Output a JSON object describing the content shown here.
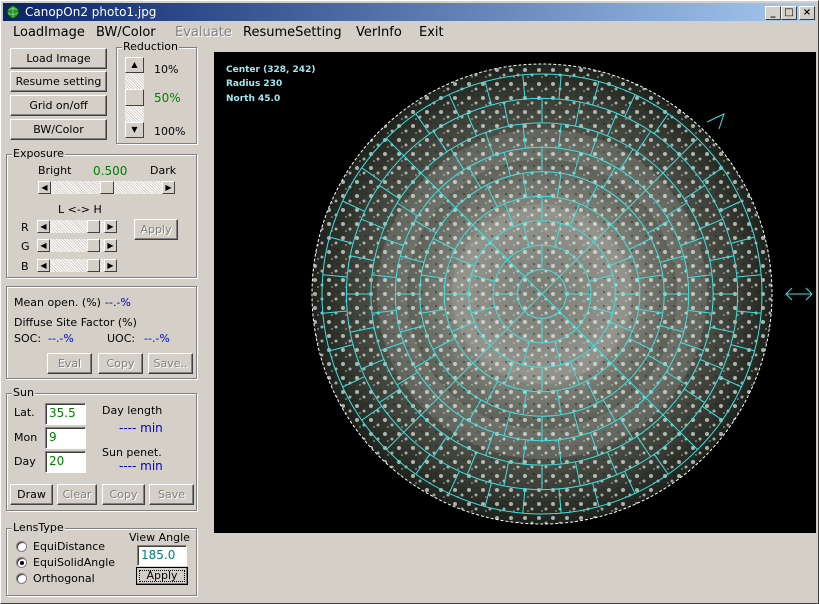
{
  "title": "CanopOn2  photo1.jpg",
  "window_buttons": {
    "minimize": "_",
    "maximize": "□",
    "close": "×"
  },
  "menu": [
    {
      "label": "LoadImage",
      "enabled": true
    },
    {
      "label": "BW/Color",
      "enabled": true
    },
    {
      "label": "Evaluate",
      "enabled": false
    },
    {
      "label": "ResumeSetting",
      "enabled": true
    },
    {
      "label": "VerInfo",
      "enabled": true
    },
    {
      "label": "Exit",
      "enabled": true
    }
  ],
  "toolbar": {
    "load_image": "Load Image",
    "resume_setting": "Resume setting",
    "grid": "Grid on/off",
    "bw_color": "BW/Color"
  },
  "reduction": {
    "title": "Reduction",
    "top": "10%",
    "current": "50%",
    "bottom": "100%"
  },
  "exposure": {
    "title": "Exposure",
    "bright": "Bright",
    "value": "0.500",
    "dark": "Dark",
    "lh": "L <-> H",
    "r": "R",
    "g": "G",
    "b": "B",
    "apply": "Apply"
  },
  "eval": {
    "mean_label": "Mean open. (%)",
    "mean_value": "--.-%",
    "dsf_label": "Diffuse Site Factor (%)",
    "soc_label": "SOC:",
    "soc_value": "--.-%",
    "uoc_label": "UOC:",
    "uoc_value": "--.-%",
    "eval_btn": "Eval",
    "copy_btn": "Copy",
    "save_btn": "Save.."
  },
  "sun": {
    "title": "Sun",
    "lat_label": "Lat.",
    "lat": "35.5",
    "mon_label": "Mon",
    "mon": "9",
    "day_label": "Day",
    "day": "20",
    "daylength_label": "Day length",
    "daylength_value": "----  min",
    "penet_label": "Sun penet.",
    "penet_value": "----  min",
    "draw": "Draw",
    "clear": "Clear",
    "copy": "Copy",
    "save": "Save"
  },
  "lens": {
    "title": "LensType",
    "options": [
      "EquiDistance",
      "EquiSolidAngle",
      "Orthogonal"
    ],
    "selected": "EquiSolidAngle",
    "view_angle_label": "View Angle",
    "view_angle": "185.0",
    "apply": "Apply"
  },
  "image_info": {
    "center": "Center (328, 242)",
    "radius": "Radius 230",
    "north": "North 45.0"
  },
  "colors": {
    "grid": "#40e0e0",
    "info_text": "#a0e8f0",
    "accent_green": "#008000",
    "accent_blue": "#0000c0",
    "titlebar_start": "#0a246a",
    "titlebar_end": "#a6caf0"
  }
}
